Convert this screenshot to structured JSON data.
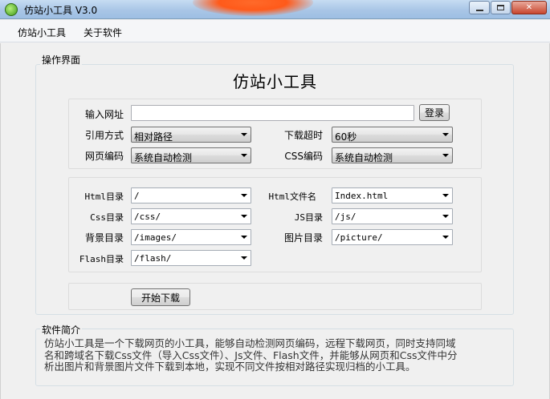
{
  "window": {
    "title": "仿站小工具 V3.0",
    "icon": "app-globe-icon",
    "buttons": [
      "minimize",
      "maximize",
      "close"
    ]
  },
  "menu": {
    "items": [
      "仿站小工具",
      "关于软件"
    ]
  },
  "operation": {
    "group_label": "操作界面",
    "heading": "仿站小工具",
    "url": {
      "label": "输入网址",
      "value": "",
      "login_button": "登录"
    },
    "ref_mode": {
      "label": "引用方式",
      "value": "相对路径"
    },
    "timeout": {
      "label": "下载超时",
      "value": "60秒"
    },
    "page_encoding": {
      "label": "网页编码",
      "value": "系统自动检测"
    },
    "css_encoding": {
      "label": "CSS编码",
      "value": "系统自动检测"
    },
    "dirs": {
      "html_dir": {
        "label": "Html目录",
        "value": "/"
      },
      "html_file": {
        "label": "Html文件名",
        "value": "Index.html"
      },
      "css_dir": {
        "label": "Css目录",
        "value": "/css/"
      },
      "js_dir": {
        "label": "JS目录",
        "value": "/js/"
      },
      "bg_dir": {
        "label": "背景目录",
        "value": "/images/"
      },
      "img_dir": {
        "label": "图片目录",
        "value": "/picture/"
      },
      "flash_dir": {
        "label": "Flash目录",
        "value": "/flash/"
      }
    },
    "start_button": "开始下载"
  },
  "about": {
    "group_label": "软件简介",
    "lines": [
      "仿站小工具是一个下载网页的小工具，能够自动检测网页编码，远程下载网页，同时支持同域",
      "名和跨域名下载Css文件（导入Css文件）、Js文件、Flash文件，并能够从网页和Css文件中分",
      "析出图片和背景图片文件下载到本地，实现不同文件按相对路径实现归档的小工具。"
    ]
  },
  "colors": {
    "title_bar": "#a9c6e6",
    "client_bg": "#f0f0f0",
    "close_button": "#c8462e"
  }
}
